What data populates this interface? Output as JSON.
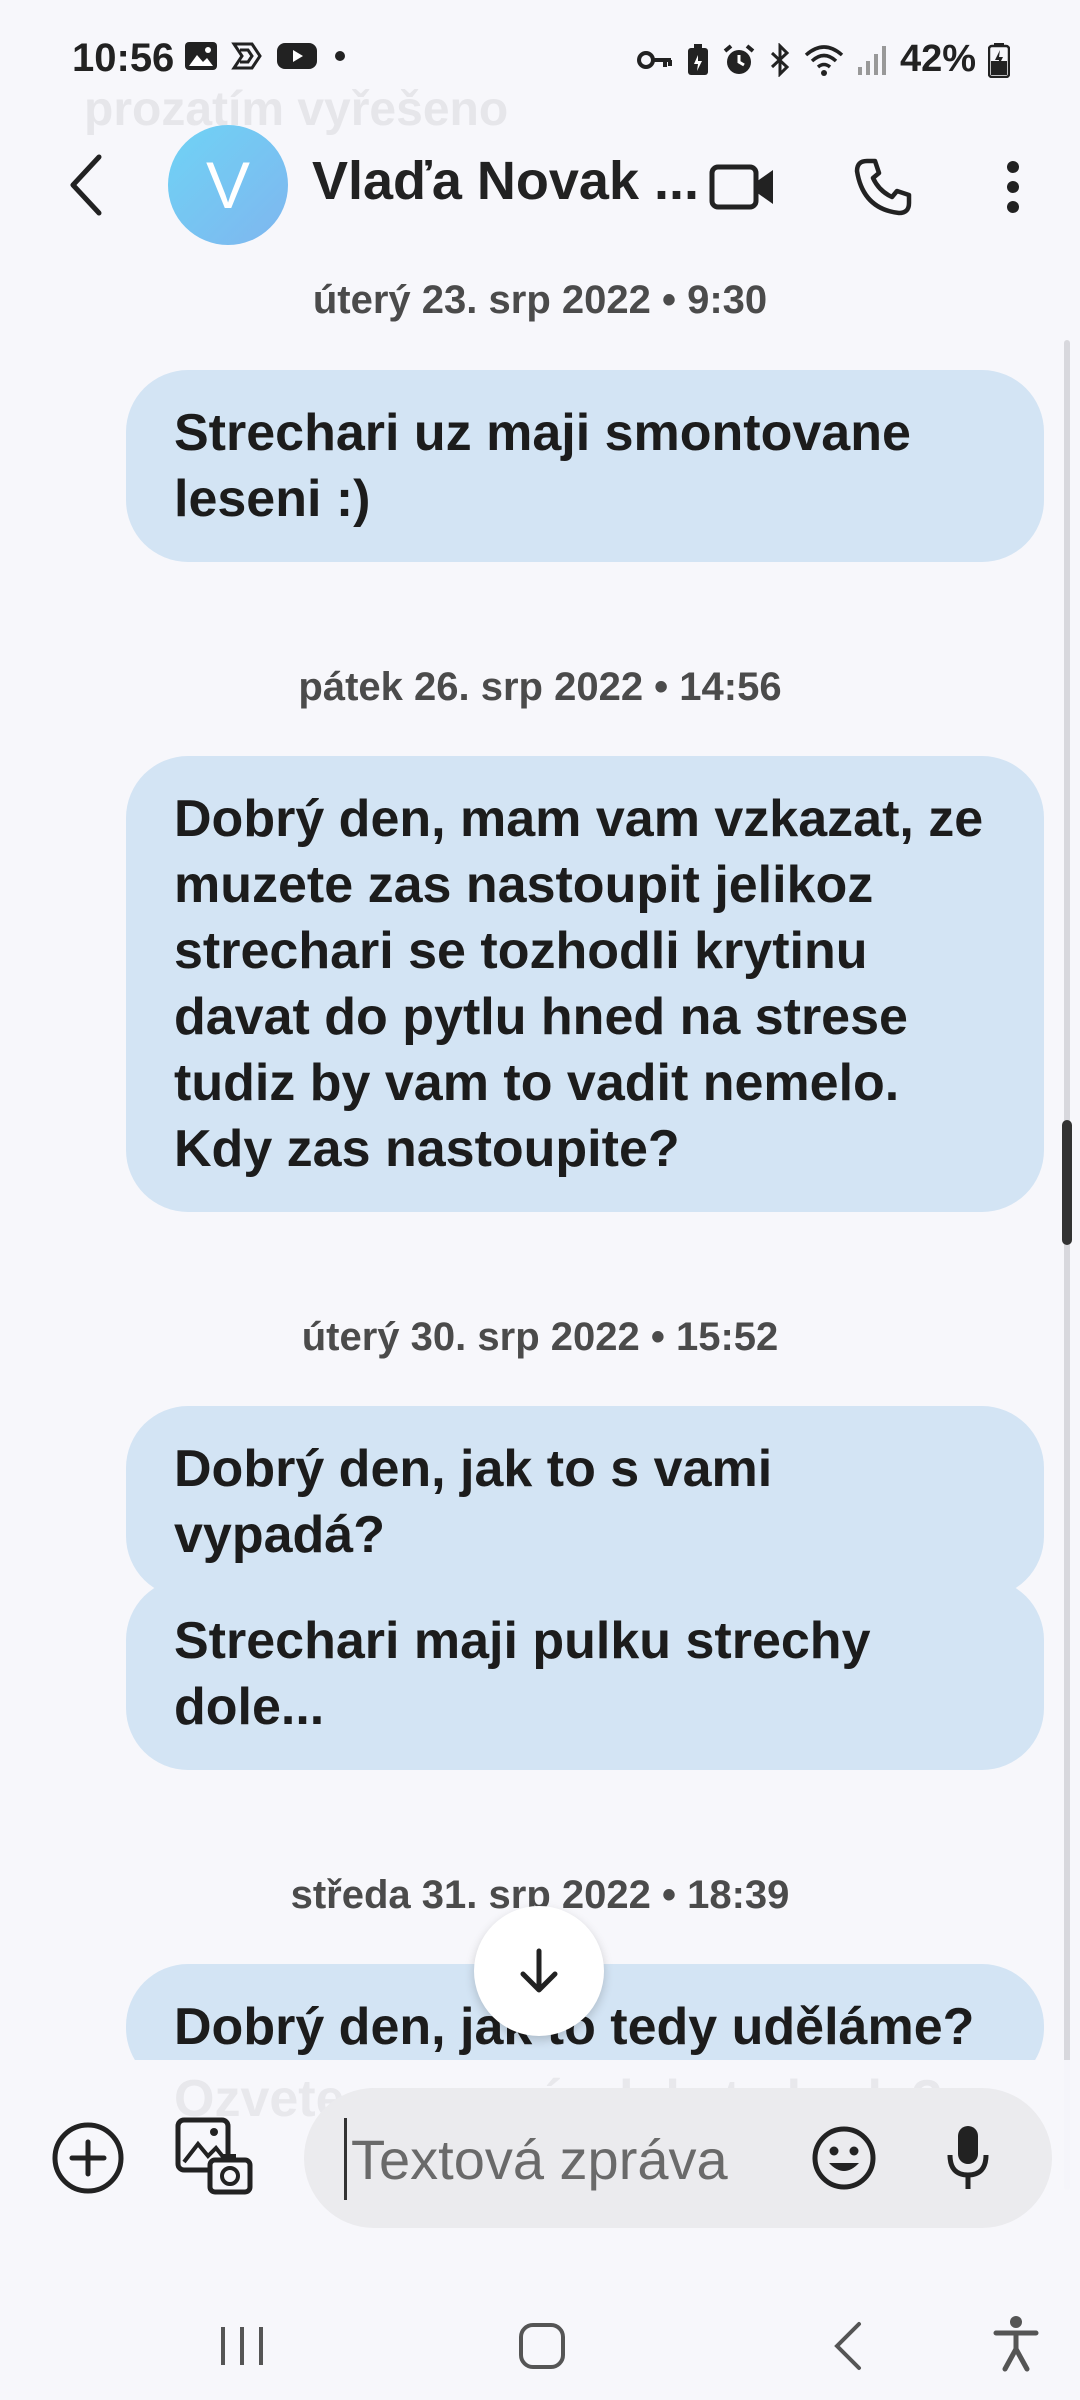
{
  "status_bar": {
    "time": "10:56",
    "battery": "42%",
    "left_icons": [
      "gallery-icon",
      "app-icon",
      "youtube-icon",
      "dot-icon"
    ],
    "right_icons": [
      "key-icon",
      "battery-saver-icon",
      "alarm-icon",
      "bluetooth-icon",
      "wifi-icon",
      "signal-icon",
      "battery-icon"
    ]
  },
  "ghost_top_text": "prozatím vyřešeno",
  "header": {
    "avatar_letter": "V",
    "contact_name": "Vlaďa Novak ..."
  },
  "conversation": {
    "groups": [
      {
        "date": "úterý 23. srp 2022 • 9:30",
        "messages": [
          "Strechari uz maji smontovane leseni :)"
        ]
      },
      {
        "date": "pátek 26. srp 2022 • 14:56",
        "messages": [
          "Dobrý den, mam vam vzkazat, ze muzete zas nastoupit jelikoz strechari se tozhodli krytinu davat do pytlu hned na strese tudiz by vam to vadit nemelo. Kdy zas nastoupite?"
        ]
      },
      {
        "date": "úterý 30. srp 2022 • 15:52",
        "messages": [
          "Dobrý den, jak to s vami vypadá?",
          "Strechari maji pulku strechy dole..."
        ]
      },
      {
        "date": "středa 31. srp 2022 • 18:39",
        "messages": [
          "Dobrý den,  jak to tedy uděláme?"
        ]
      }
    ],
    "ghost_bottom_text": "Ozvete se prosím kdy to bude?"
  },
  "input": {
    "placeholder": "Textová zpráva"
  },
  "colors": {
    "bubble": "#d3e4f4",
    "background": "#f7f7fb",
    "input_bg": "#ebebee",
    "avatar_start": "#6fd3f5",
    "avatar_end": "#7fb6ef"
  }
}
